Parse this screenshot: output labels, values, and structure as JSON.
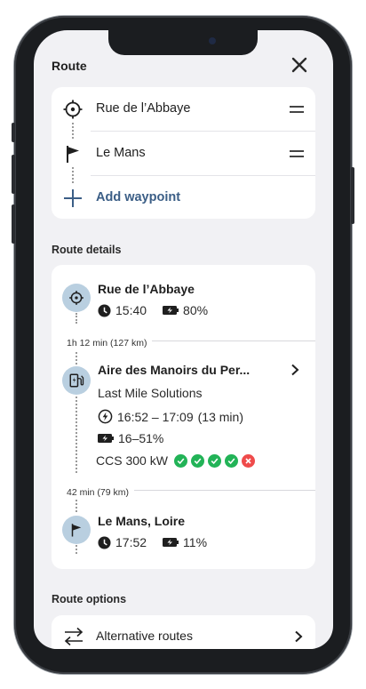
{
  "header": {
    "title": "Route"
  },
  "route": {
    "waypoints": [
      {
        "label": "Rue de l’Abbaye",
        "icon": "crosshair-icon"
      },
      {
        "label": "Le Mans",
        "icon": "flag-icon"
      }
    ],
    "add_label": "Add waypoint"
  },
  "details": {
    "title": "Route details",
    "start": {
      "name": "Rue de l’Abbaye",
      "time": "15:40",
      "battery": "80%"
    },
    "leg1": "1h 12 min (127 km)",
    "charge": {
      "name": "Aire des Manoirs du Per...",
      "operator": "Last Mile Solutions",
      "time_range": "16:52 – 17:09",
      "duration": "(13 min)",
      "soc": "16–51%",
      "connector": "CCS 300 kW",
      "availability": [
        "ok",
        "ok",
        "ok",
        "ok",
        "err"
      ]
    },
    "leg2": "42 min (79 km)",
    "end": {
      "name": "Le Mans, Loire",
      "time": "17:52",
      "battery": "11%"
    }
  },
  "options": {
    "title": "Route options",
    "alternative": "Alternative routes"
  },
  "colors": {
    "accent": "#3b5e86",
    "stop_icon_bg": "#b9cfe0",
    "ok": "#22b357",
    "error": "#ef4b4b",
    "screen_bg": "#f1f1f4"
  }
}
